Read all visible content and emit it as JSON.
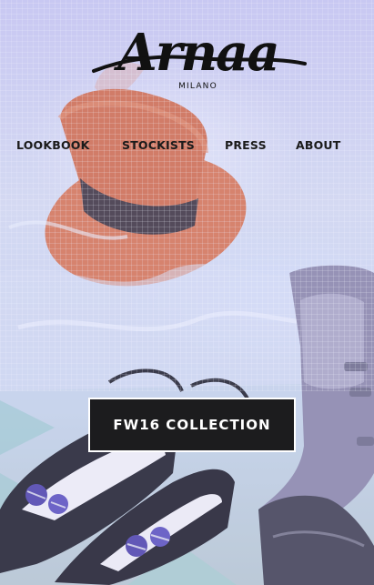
{
  "brand": {
    "name": "Arnaa",
    "subtitle": "MILANO"
  },
  "nav": {
    "items": [
      {
        "label": "LOOKBOOK"
      },
      {
        "label": "STOCKISTS"
      },
      {
        "label": "PRESS"
      },
      {
        "label": "ABOUT"
      }
    ]
  },
  "cta": {
    "label": "FW16 COLLECTION"
  },
  "colors": {
    "hat": "#d9734f",
    "button_bg": "#1c1c1e",
    "button_border": "#ffffff",
    "fabric": "#d2d8f0"
  }
}
